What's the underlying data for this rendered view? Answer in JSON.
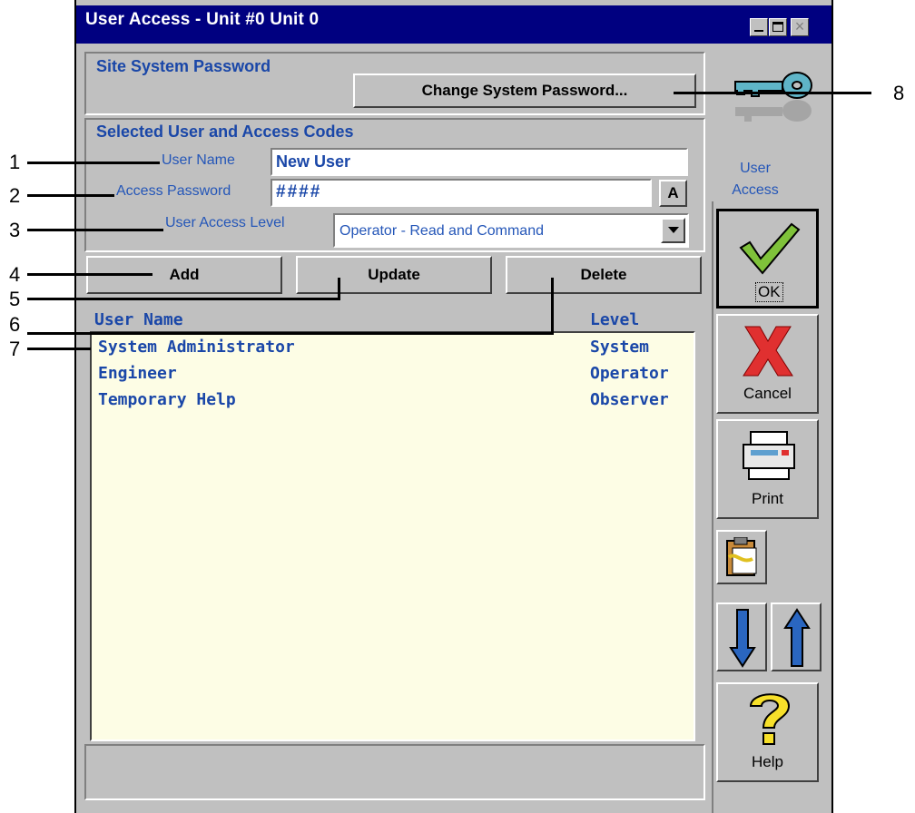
{
  "window": {
    "title": "User Access - Unit #0 Unit 0",
    "minimize_glyph": "_",
    "maximize_glyph": "□",
    "close_glyph": "×"
  },
  "site_password": {
    "heading": "Site System Password",
    "change_button": "Change System Password..."
  },
  "selected_user": {
    "heading": "Selected User and Access Codes",
    "user_name_label": "User Name",
    "user_name_value": "New User",
    "password_label": "Access Password",
    "password_value": "####",
    "password_button": "A",
    "level_label": "User Access Level",
    "level_value": "Operator - Read and Command"
  },
  "actions": {
    "add": "Add",
    "update": "Update",
    "delete": "Delete"
  },
  "user_list": {
    "col_name": "User Name",
    "col_level": "Level",
    "rows": [
      {
        "name": "System Administrator",
        "level": "System"
      },
      {
        "name": "Engineer",
        "level": "Operator"
      },
      {
        "name": "Temporary Help",
        "level": "Observer"
      }
    ]
  },
  "sidebar": {
    "label_line1": "User",
    "label_line2": "Access",
    "ok": "OK",
    "cancel": "Cancel",
    "print": "Print",
    "help": "Help"
  },
  "callouts": {
    "c1": "1",
    "c2": "2",
    "c3": "3",
    "c4": "4",
    "c5": "5",
    "c6": "6",
    "c7": "7",
    "c8": "8"
  },
  "colors": {
    "title_bar": "#000080",
    "face": "#c0c0c0",
    "list_bg": "#fdfde5",
    "text_blue": "#1a47a8"
  }
}
